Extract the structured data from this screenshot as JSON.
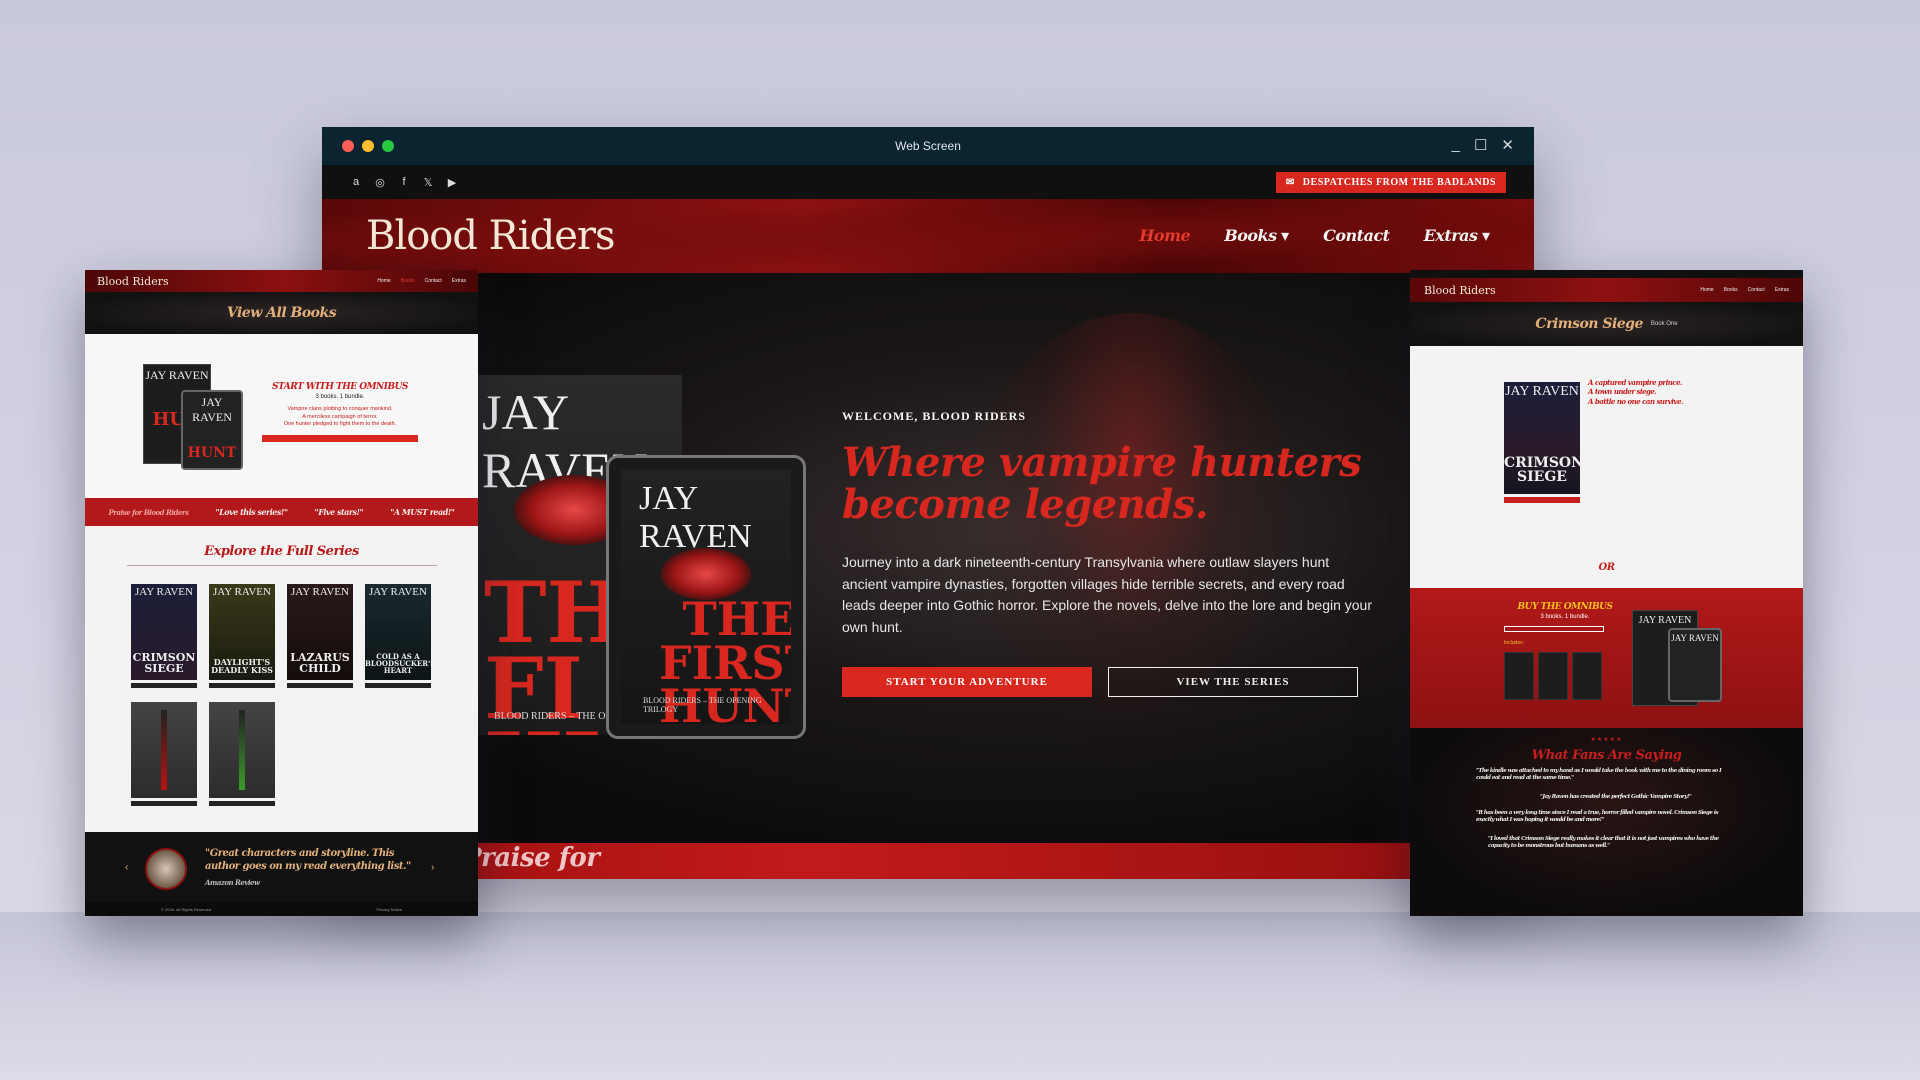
{
  "window": {
    "title": "Web Screen",
    "traffic_lights": [
      "#ff5f57",
      "#febc2e",
      "#28c840"
    ]
  },
  "topbar": {
    "social_icons": [
      "amazon-icon",
      "instagram-icon",
      "facebook-icon",
      "x-icon",
      "youtube-icon"
    ],
    "social_glyphs": [
      "a",
      "◎",
      "f",
      "𝕏",
      "▶"
    ],
    "despatch_label": "DESPATCHES FROM THE BADLANDS"
  },
  "nav": {
    "logo": "Blood Riders",
    "links": [
      {
        "label": "Home",
        "active": true
      },
      {
        "label": "Books",
        "dropdown": true
      },
      {
        "label": "Contact"
      },
      {
        "label": "Extras",
        "dropdown": true
      }
    ]
  },
  "hero": {
    "eyebrow": "WELCOME, BLOOD RIDERS",
    "headline": "Where vampire hunters become legends.",
    "body": "Journey into a dark nineteenth-century Transylvania where outlaw slayers hunt ancient vampire dynasties, forgotten villages hide terrible secrets, and every road leads deeper into Gothic horror. Explore the novels, delve into the lore and begin your own hunt.",
    "cta_primary": "START YOUR ADVENTURE",
    "cta_secondary": "VIEW THE SERIES",
    "book_author": "JAY RAVEN",
    "book_title": "THE FIRST HUNT",
    "book_title_line1": "THE FIRST",
    "book_title_line2": "HUNT",
    "book_back_title": "THE FI HUNT",
    "book_footer": "BLOOD RIDERS – THE OPENING TRILOGY",
    "book_back_footer": "BLOOD RIDERS – THE OPE",
    "praise_strip": "Praise for"
  },
  "left_page": {
    "logo": "Blood Riders",
    "nav_links": [
      "Home",
      "Books",
      "Contact",
      "Extras"
    ],
    "header": "View All Books",
    "omnibus": {
      "author": "JAY RAVEN",
      "title": "START WITH THE OMNIBUS",
      "subtitle": "3 books. 1 bundle.",
      "desc1": "Vampire clans plotting to conquer mankind.",
      "desc2": "A merciless campaign of terror.",
      "desc3": "One hunter pledged to fight them to the death.",
      "cover_title": "HUN",
      "tablet_title": "HUNT"
    },
    "praise": [
      "Praise for Blood Riders",
      "\"Love this series!\"",
      "\"Five stars!\"",
      "\"A MUST read!\""
    ],
    "series_title": "Explore the Full Series",
    "books": [
      {
        "author": "JAY RAVEN",
        "title": "CRIMSON SIEGE",
        "color": "#1b1f3a"
      },
      {
        "author": "JAY RAVEN",
        "title": "DAYLIGHT'S DEADLY KISS",
        "color": "#3a3a1a"
      },
      {
        "author": "JAY RAVEN",
        "title": "LAZARUS CHILD",
        "color": "#2a1a1a"
      },
      {
        "author": "JAY RAVEN",
        "title": "COLD AS A BLOODSUCKER'S HEART",
        "color": "#1a2a2e"
      }
    ],
    "review": {
      "quote": "\"Great characters and storyline. This author goes on my read everything list.\"",
      "source": "Amazon Review",
      "prev": "‹",
      "next": "›"
    },
    "footer_left": "© 2026. All Rights Reserved",
    "footer_right": "Privacy Notice"
  },
  "right_page": {
    "logo": "Blood Riders",
    "nav_links": [
      "Home",
      "Books",
      "Contact",
      "Extras"
    ],
    "header_title": "Crimson Siege",
    "header_sub": "Book One",
    "cover_author": "JAY RAVEN",
    "cover_title": "CRIMSON SIEGE",
    "blurb_1": "A captured vampire prince.",
    "blurb_2": "A town under siege.",
    "blurb_3": "A battle no one can survive.",
    "or": "OR",
    "omnibus_title": "BUY THE OMNIBUS",
    "omnibus_sub": "3 books. 1 bundle.",
    "omnibus_includes": "Includes:",
    "omnibus_cover_author": "JAY RAVEN",
    "omnibus_tablet_author": "JAY RAVEN",
    "stars": "★★★★★",
    "fans_title": "What Fans Are Saying",
    "quotes": [
      "\"The kindle was attached to my hand as I would take the book with me to the dining room so I could eat and read at the same time.\"",
      "\"Jay Raven has created the perfect Gothic Vampire Story!\"",
      "\"It has been a very long time since I read a true, horror filled vampire novel. Crimson Siege is exactly what I was hoping it would be and more!\"",
      "\"I loved that Crimson Siege really makes it clear that it is not just vampires who have the capacity to be monstrous but humans as well.\""
    ]
  }
}
